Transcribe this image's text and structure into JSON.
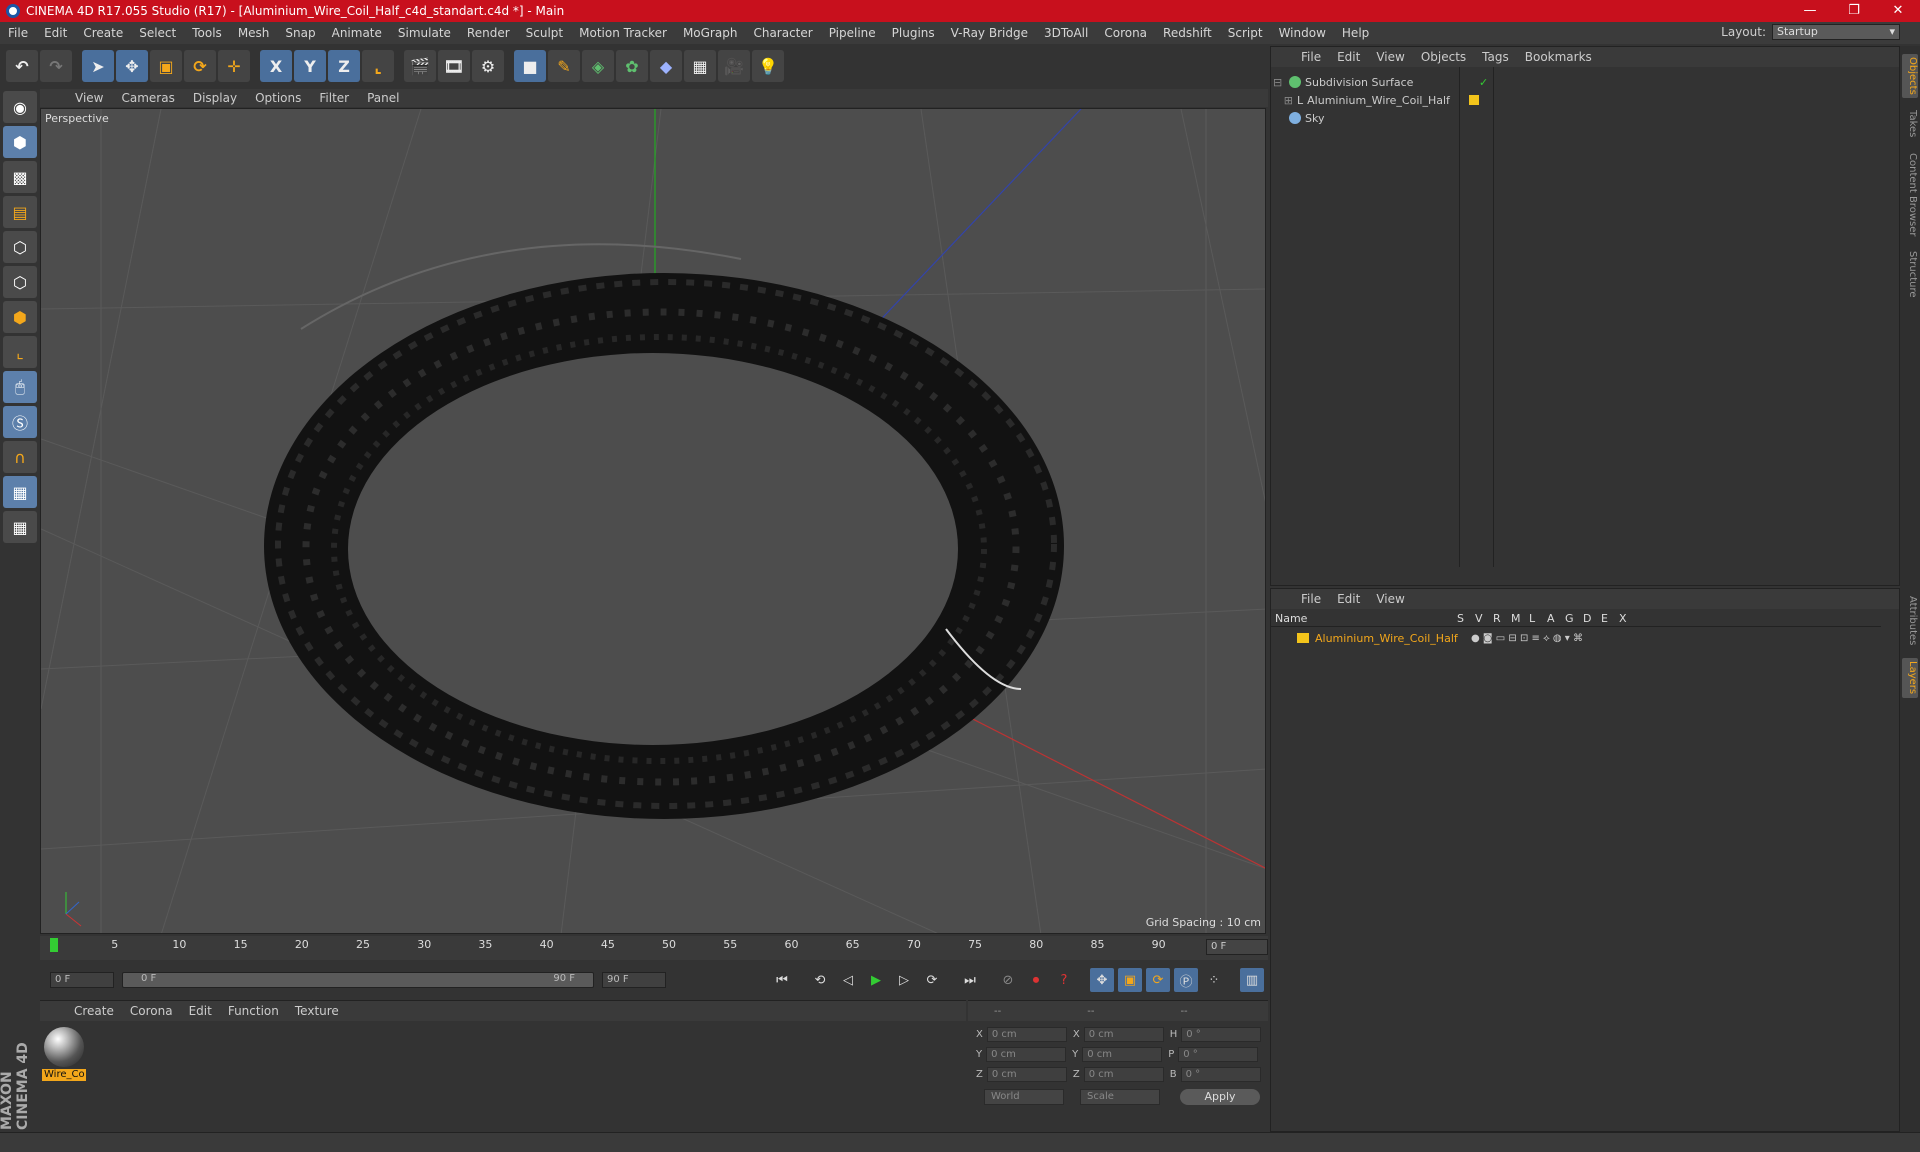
{
  "window": {
    "title": "CINEMA 4D R17.055 Studio (R17) - [Aluminium_Wire_Coil_Half_c4d_standart.c4d *] - Main",
    "minimize": "—",
    "maximize": "❐",
    "close": "✕"
  },
  "menubar": {
    "items": [
      "File",
      "Edit",
      "Create",
      "Select",
      "Tools",
      "Mesh",
      "Snap",
      "Animate",
      "Simulate",
      "Render",
      "Sculpt",
      "Motion Tracker",
      "MoGraph",
      "Character",
      "Pipeline",
      "Plugins",
      "V-Ray Bridge",
      "3DToAll",
      "Corona",
      "Redshift",
      "Script",
      "Window",
      "Help"
    ]
  },
  "layout": {
    "label": "Layout:",
    "value": "Startup"
  },
  "toolbar": {
    "axis_x": "X",
    "axis_y": "Y",
    "axis_z": "Z"
  },
  "viewport": {
    "menu": [
      "View",
      "Cameras",
      "Display",
      "Options",
      "Filter",
      "Panel"
    ],
    "label": "Perspective",
    "grid_spacing": "Grid Spacing : 10 cm"
  },
  "timeline": {
    "ticks": [
      "0",
      "5",
      "10",
      "15",
      "20",
      "25",
      "30",
      "35",
      "40",
      "45",
      "50",
      "55",
      "60",
      "65",
      "70",
      "75",
      "80",
      "85",
      "90"
    ],
    "frame_display": "0 F"
  },
  "transport": {
    "start": "0 F",
    "range_start": "0 F",
    "range_end": "90 F",
    "end": "90 F"
  },
  "material_panel": {
    "menu": [
      "Create",
      "Corona",
      "Edit",
      "Function",
      "Texture"
    ],
    "material_name": "Wire_Co"
  },
  "coordinates": {
    "header": [
      "--",
      "--",
      "--"
    ],
    "rows": [
      {
        "a": "X",
        "a_val": "0 cm",
        "b": "X",
        "b_val": "0 cm",
        "c": "H",
        "c_val": "0 °"
      },
      {
        "a": "Y",
        "a_val": "0 cm",
        "b": "Y",
        "b_val": "0 cm",
        "c": "P",
        "c_val": "0 °"
      },
      {
        "a": "Z",
        "a_val": "0 cm",
        "b": "Z",
        "b_val": "0 cm",
        "c": "B",
        "c_val": "0 °"
      }
    ],
    "mode1": "World",
    "mode2": "Scale",
    "apply": "Apply"
  },
  "object_manager": {
    "menu": [
      "File",
      "Edit",
      "View",
      "Objects",
      "Tags",
      "Bookmarks"
    ],
    "objects": [
      {
        "name": "Subdivision Surface",
        "color": "#5fc06f"
      },
      {
        "name": "Aluminium_Wire_Coil_Half",
        "color": "#d8d8d8"
      },
      {
        "name": "Sky",
        "color": "#7fb0e0"
      }
    ]
  },
  "layer_manager": {
    "menu": [
      "File",
      "Edit",
      "View"
    ],
    "columns": [
      "Name",
      "S",
      "V",
      "R",
      "M",
      "L",
      "A",
      "G",
      "D",
      "E",
      "X"
    ],
    "layers": [
      {
        "name": "Aluminium_Wire_Coil_Half",
        "color": "#f3c41b"
      }
    ]
  },
  "side_tabs": [
    "Objects",
    "Takes",
    "Content Browser",
    "Structure",
    "Attributes",
    "Layers"
  ],
  "branding": "MAXON CINEMA 4D",
  "colors": {
    "title_red": "#c8101d",
    "accent_orange": "#f3a71b",
    "tool_blue": "#4a6f9c"
  }
}
